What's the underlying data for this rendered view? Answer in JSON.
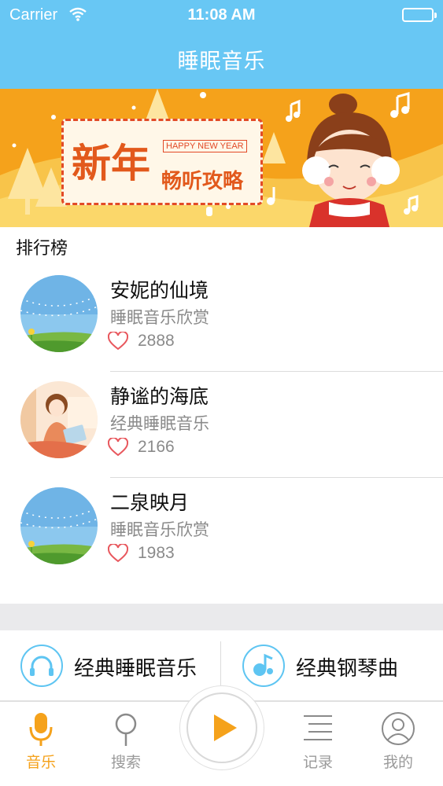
{
  "status_bar": {
    "carrier": "Carrier",
    "time": "11:08 AM"
  },
  "nav": {
    "title": "睡眠音乐"
  },
  "banner": {
    "headline": "新年",
    "tag": "HAPPY NEW YEAR",
    "subline": "畅听攻略"
  },
  "ranking": {
    "title": "排行榜",
    "items": [
      {
        "name": "安妮的仙境",
        "subtitle": "睡眠音乐欣赏",
        "likes": "2888"
      },
      {
        "name": "静谧的海底",
        "subtitle": "经典睡眠音乐",
        "likes": "2166"
      },
      {
        "name": "二泉映月",
        "subtitle": "睡眠音乐欣赏",
        "likes": "1983"
      }
    ]
  },
  "categories": [
    {
      "label": "经典睡眠音乐",
      "icon": "headphones-icon"
    },
    {
      "label": "经典钢琴曲",
      "icon": "music-note-icon"
    }
  ],
  "tabbar": {
    "tabs": [
      {
        "label": "音乐",
        "icon": "microphone-icon",
        "active": true
      },
      {
        "label": "搜索",
        "icon": "search-icon",
        "active": false
      },
      {
        "label": "记录",
        "icon": "list-icon",
        "active": false
      },
      {
        "label": "我的",
        "icon": "user-icon",
        "active": false
      }
    ],
    "play_icon": "play-icon"
  },
  "colors": {
    "header": "#68c7f4",
    "accent": "#f5a21b",
    "heart": "#e8575d",
    "category_ring": "#5ec5f2"
  }
}
